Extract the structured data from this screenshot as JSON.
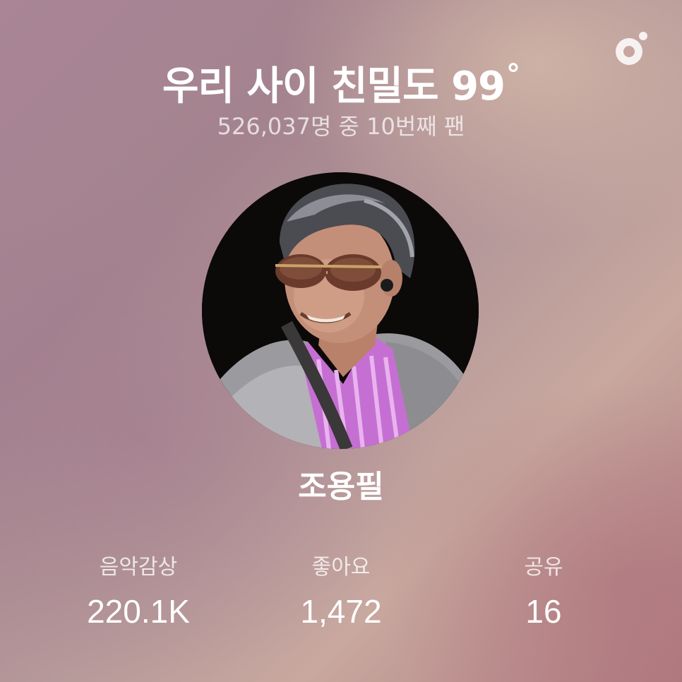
{
  "header": {
    "title": "우리 사이 친밀도 99",
    "degree_symbol": "°",
    "subtitle": "526,037명 중 10번째 팬"
  },
  "brand": {
    "icon": "record-dot-logo-icon"
  },
  "artist": {
    "name": "조용필",
    "avatar_icon": "artist-photo"
  },
  "stats": [
    {
      "label": "음악감상",
      "value": "220.1K"
    },
    {
      "label": "좋아요",
      "value": "1,472"
    },
    {
      "label": "공유",
      "value": "16"
    }
  ],
  "colors": {
    "background_top_right": "#cba99d",
    "background_left": "#a68594",
    "background_bottom_right": "#b07a80",
    "text": "#ffffff"
  }
}
